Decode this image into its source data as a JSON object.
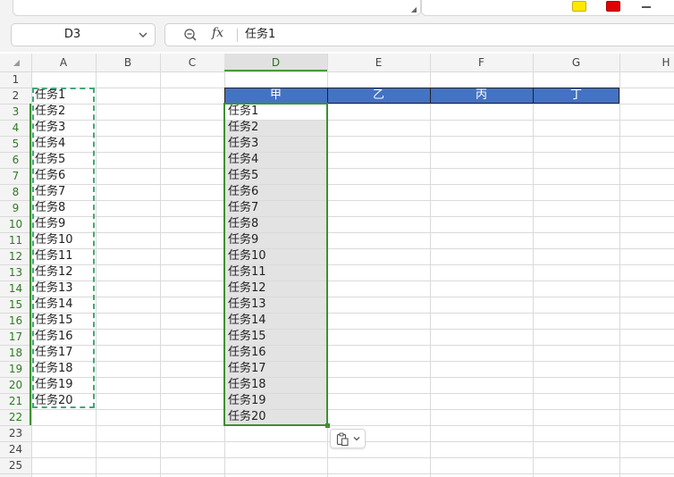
{
  "formula_bar": {
    "name_box": "D3",
    "fx_label": "fx",
    "value": "任务1"
  },
  "columns": [
    "A",
    "B",
    "C",
    "D",
    "E",
    "F",
    "G",
    "H"
  ],
  "selected_column": "D",
  "rows": [
    "1",
    "2",
    "3",
    "4",
    "5",
    "6",
    "7",
    "8",
    "9",
    "10",
    "11",
    "12",
    "13",
    "14",
    "15",
    "16",
    "17",
    "18",
    "19",
    "20",
    "21",
    "22",
    "23",
    "24",
    "25"
  ],
  "column_a_values": [
    "任务1",
    "任务2",
    "任务3",
    "任务4",
    "任务5",
    "任务6",
    "任务7",
    "任务8",
    "任务9",
    "任务10",
    "任务11",
    "任务12",
    "任务13",
    "任务14",
    "任务15",
    "任务16",
    "任务17",
    "任务18",
    "任务19",
    "任务20"
  ],
  "table_headers": [
    "甲",
    "乙",
    "丙",
    "丁"
  ],
  "column_d_values": [
    "任务1",
    "任务2",
    "任务3",
    "任务4",
    "任务5",
    "任务6",
    "任务7",
    "任务8",
    "任务9",
    "任务10",
    "任务11",
    "任务12",
    "任务13",
    "任务14",
    "任务15",
    "任务16",
    "任务17",
    "任务18",
    "任务19",
    "任务20"
  ],
  "colors": {
    "header_fill": "#4472c4",
    "selection_border": "#3f8f2f",
    "copy_marquee": "#3fa77a",
    "selection_fill": "#e3e3e3"
  },
  "icons": {
    "zoom": "zoom-out-icon",
    "paste_options": "clipboard-icon"
  }
}
